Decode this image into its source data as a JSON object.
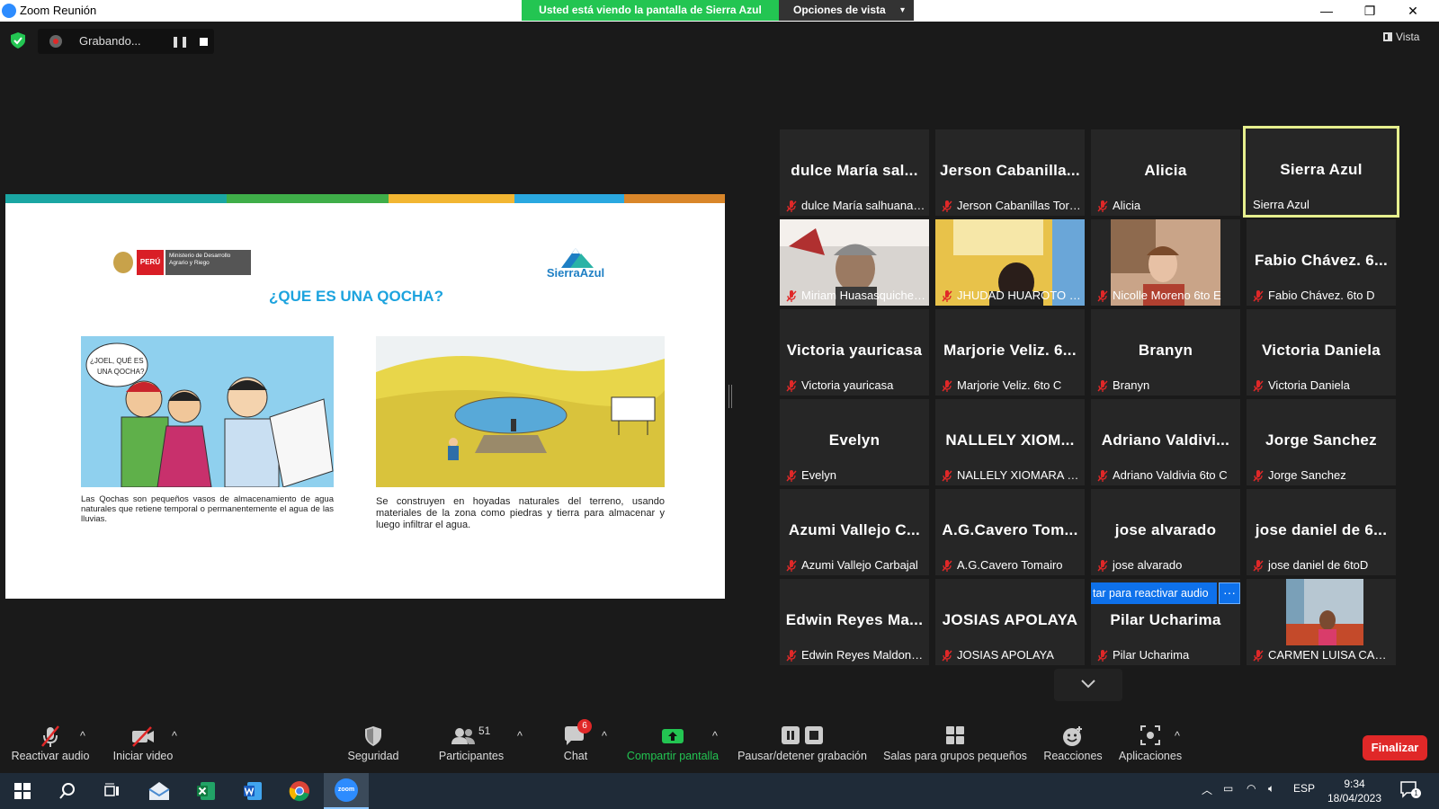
{
  "window": {
    "title": "Zoom Reunión",
    "minimize": "—",
    "restore": "❐",
    "close": "✕"
  },
  "share_banner": {
    "text": "Usted está viendo la pantalla de Sierra Azul",
    "view_options": "Opciones de vista"
  },
  "recording": {
    "label": "Grabando..."
  },
  "view_button": {
    "label": "Vista"
  },
  "slide": {
    "title": "¿QUE ES UNA QOCHA?",
    "ministry_peru": "PERÚ",
    "ministry_name": "Ministerio de Desarrollo Agrario y Riego",
    "brand": "SierraAzul",
    "bubble_text": "¿JOEL, QUÉ ES UNA QOCHA?",
    "caption_left": "Las Qochas son pequeños vasos de almacenamiento de agua naturales que retiene temporal o permanentemente el agua de las lluvias.",
    "caption_right": "Se construyen en hoyadas naturales del terreno, usando materiales de la zona como piedras y tierra para almacenar y luego infiltrar el agua.",
    "stripe_colors": [
      "#1aa6a3",
      "#3fae49",
      "#f2b632",
      "#2aa8e0",
      "#d9862a"
    ]
  },
  "participants": [
    {
      "big": "dulce María sal...",
      "name": "dulce María salhuana ...",
      "muted": true
    },
    {
      "big": "Jerson  Cabanilla...",
      "name": "Jerson Cabanillas Torre...",
      "muted": true
    },
    {
      "big": "Alicia",
      "name": "Alicia",
      "muted": true
    },
    {
      "big": "Sierra Azul",
      "name": "Sierra Azul",
      "muted": false,
      "active": true
    },
    {
      "big": "",
      "name": "Miriam Huasasquiche-...",
      "muted": true,
      "video": "miriam"
    },
    {
      "big": "",
      "name": "JHUDAD HUAROTO C...",
      "muted": true,
      "video": "jhudad"
    },
    {
      "big": "",
      "name": "Nicolle Moreno 6to E",
      "muted": true,
      "video": "nicolle"
    },
    {
      "big": "Fabio Chávez. 6...",
      "name": "Fabio Chávez. 6to D",
      "muted": true
    },
    {
      "big": "Victoria yauricasa",
      "name": "Victoria yauricasa",
      "muted": true
    },
    {
      "big": "Marjorie Veliz. 6...",
      "name": "Marjorie Veliz. 6to C",
      "muted": true
    },
    {
      "big": "Branyn",
      "name": "Branyn",
      "muted": true
    },
    {
      "big": "Victoria Daniela",
      "name": "Victoria Daniela",
      "muted": true
    },
    {
      "big": "Evelyn",
      "name": "Evelyn",
      "muted": true
    },
    {
      "big": "NALLELY  XIOM...",
      "name": "NALLELY XIOMARA NE...",
      "muted": true
    },
    {
      "big": "Adriano  Valdivi...",
      "name": "Adriano Valdivia 6to C",
      "muted": true
    },
    {
      "big": "Jorge Sanchez",
      "name": "Jorge Sanchez",
      "muted": true
    },
    {
      "big": "Azumi Vallejo C...",
      "name": "Azumi Vallejo Carbajal",
      "muted": true
    },
    {
      "big": "A.G.Cavero  Tom...",
      "name": "A.G.Cavero Tomairo",
      "muted": true
    },
    {
      "big": "jose alvarado",
      "name": "jose alvarado",
      "muted": true
    },
    {
      "big": "jose daniel de 6...",
      "name": "jose daniel de 6toD",
      "muted": true
    },
    {
      "big": "Edwin Reyes Ma...",
      "name": "Edwin Reyes Maldona...",
      "muted": true
    },
    {
      "big": "JOSIAS APOLAYA",
      "name": "JOSIAS APOLAYA",
      "muted": true
    },
    {
      "big": "Pilar Ucharima",
      "name": "Pilar Ucharima",
      "muted": true
    },
    {
      "big": "",
      "name": "CARMEN LUISA CASTI...",
      "muted": true,
      "video": "carmen"
    }
  ],
  "unmute_banner": {
    "text": "tar para reactivar audio",
    "more": "···"
  },
  "toolbar": {
    "unmute": "Reactivar audio",
    "start_video": "Iniciar video",
    "security": "Seguridad",
    "participants": "Participantes",
    "participants_count": "51",
    "chat": "Chat",
    "chat_badge": "6",
    "share": "Compartir pantalla",
    "pause_record": "Pausar/detener grabación",
    "breakout": "Salas para grupos pequeños",
    "reactions": "Reacciones",
    "apps": "Aplicaciones",
    "end": "Finalizar"
  },
  "taskbar": {
    "zoom_label": "zoom",
    "lang": "ESP",
    "time": "9:34",
    "date": "18/04/2023",
    "notif_count": "1"
  },
  "colors": {
    "accent_green": "#23c552",
    "end_red": "#e02828",
    "zoom_blue": "#0e71eb",
    "active_border": "#e6ef8e"
  }
}
